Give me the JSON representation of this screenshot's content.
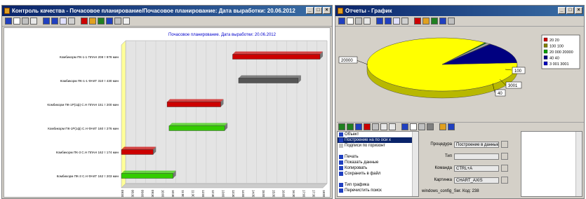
{
  "left_window": {
    "title": "Контроль качества - Почасовое планирование/Почасовое планирование: Дата выработки: 20.06.2012",
    "controls": [
      "_",
      "□",
      "×"
    ],
    "toolbar_icons": [
      "open-icon",
      "print-icon",
      "chart-icon",
      "copy-icon",
      "save-icon",
      "preview-icon",
      "table-icon",
      "props-icon",
      "color-icon",
      "layout-icon",
      "refresh-icon",
      "export-icon",
      "settings-icon",
      "help-icon"
    ]
  },
  "right_window": {
    "title": "Отчеты - График",
    "controls": [
      "_",
      "□",
      "×"
    ],
    "toolbar_icons": [
      "open-icon",
      "print-icon",
      "chart-icon",
      "copy-icon",
      "save-icon",
      "preview-icon",
      "table-icon",
      "props-icon",
      "color-icon",
      "layout-icon",
      "refresh-icon",
      "export-icon",
      "settings-icon",
      "help-icon"
    ]
  },
  "chart_data": [
    {
      "type": "gantt",
      "title": "Почасовое планирование. Дата выработки: 20.06.2012",
      "categories": [
        "Комбикорм ПК-1-1 ПЛАН 208 т 978 мин",
        "Комбикорм ПК-1-1 ФАКТ 310 т 430 мин",
        "Комбикорм ПК-1Р(1ф) С.Н ПЛАН 151 т 200 мин",
        "Комбикорм ПК-1Р(1ф) С.Н ФАКТ 160 т 276 мин",
        "Комбикорм ПК-3 С.Н ПЛАН 162 т 174 мин",
        "Комбикорм ПК-3 С.Н ФАКТ 162 т 203 мин"
      ],
      "bars": [
        {
          "start": 0.56,
          "end": 1.0,
          "color": "#cc0000"
        },
        {
          "start": 0.59,
          "end": 0.89,
          "color": "#555555"
        },
        {
          "start": 0.23,
          "end": 0.5,
          "color": "#cc0000"
        },
        {
          "start": 0.24,
          "end": 0.52,
          "color": "#33cc00"
        },
        {
          "start": 0.0,
          "end": 0.16,
          "color": "#cc0000"
        },
        {
          "start": 0.0,
          "end": 0.26,
          "color": "#33cc00"
        }
      ],
      "x_ticks": [
        "08:00",
        "08:30",
        "09:00",
        "09:30",
        "10:00",
        "10:30",
        "11:00",
        "11:30",
        "12:00",
        "12:30",
        "13:00",
        "13:30",
        "14:00",
        "14:30",
        "15:00",
        "15:30",
        "16:00",
        "16:30",
        "17:00",
        "17:30",
        "18:00"
      ]
    },
    {
      "type": "pie",
      "slices": [
        {
          "label": "20 20",
          "value": 20000,
          "color": "#ffff00"
        },
        {
          "label": "100 100",
          "value": 100,
          "color": "#008000"
        },
        {
          "label": "20 000 20000",
          "value": 200,
          "color": "#a8a8a8"
        },
        {
          "label": "40 40",
          "value": 40,
          "color": "#808080"
        },
        {
          "label": "3 001 3001",
          "value": 3001,
          "color": "#000080"
        }
      ],
      "callouts": [
        "20000",
        "100",
        "3001",
        "40"
      ],
      "legend": [
        "20 20",
        "100 100",
        "20 000 20000",
        "40 40",
        "3 001 3001"
      ],
      "legend_colors": [
        "#cc0000",
        "#808000",
        "#00a000",
        "#000080",
        "#0000c0"
      ]
    }
  ],
  "props_panel": {
    "tree_items": [
      {
        "label": "Объект",
        "selected": false,
        "icon_color": "#2040c0"
      },
      {
        "label": "Построение на по оси х",
        "selected": true,
        "icon_color": "#2040c0"
      },
      {
        "label": "Подписи по горизонт",
        "selected": false,
        "icon_color": "#c0c0c0"
      },
      {
        "label": "",
        "selected": false,
        "icon_color": "#ffffff"
      },
      {
        "label": "Печать",
        "selected": false,
        "icon_color": "#2040c0"
      },
      {
        "label": "Показать данные",
        "selected": false,
        "icon_color": "#2040c0"
      },
      {
        "label": "Копировать",
        "selected": false,
        "icon_color": "#2040c0"
      },
      {
        "label": "Сохранить в файл",
        "selected": false,
        "icon_color": "#2040c0"
      },
      {
        "label": "",
        "selected": false,
        "icon_color": "#ffffff"
      },
      {
        "label": "Тип графика",
        "selected": false,
        "icon_color": "#2040c0"
      },
      {
        "label": "Перечистить поиск",
        "selected": false,
        "icon_color": "#2040c0"
      }
    ],
    "fields": [
      {
        "label": "Процедура",
        "value": "Построение в данные"
      },
      {
        "label": "Тип",
        "value": ""
      },
      {
        "label": "Команда",
        "value": "CTRL+A"
      },
      {
        "label": "Картинка",
        "value": "CHART_AXIS"
      }
    ],
    "status": "windows_config_Ser. Код: 238"
  }
}
